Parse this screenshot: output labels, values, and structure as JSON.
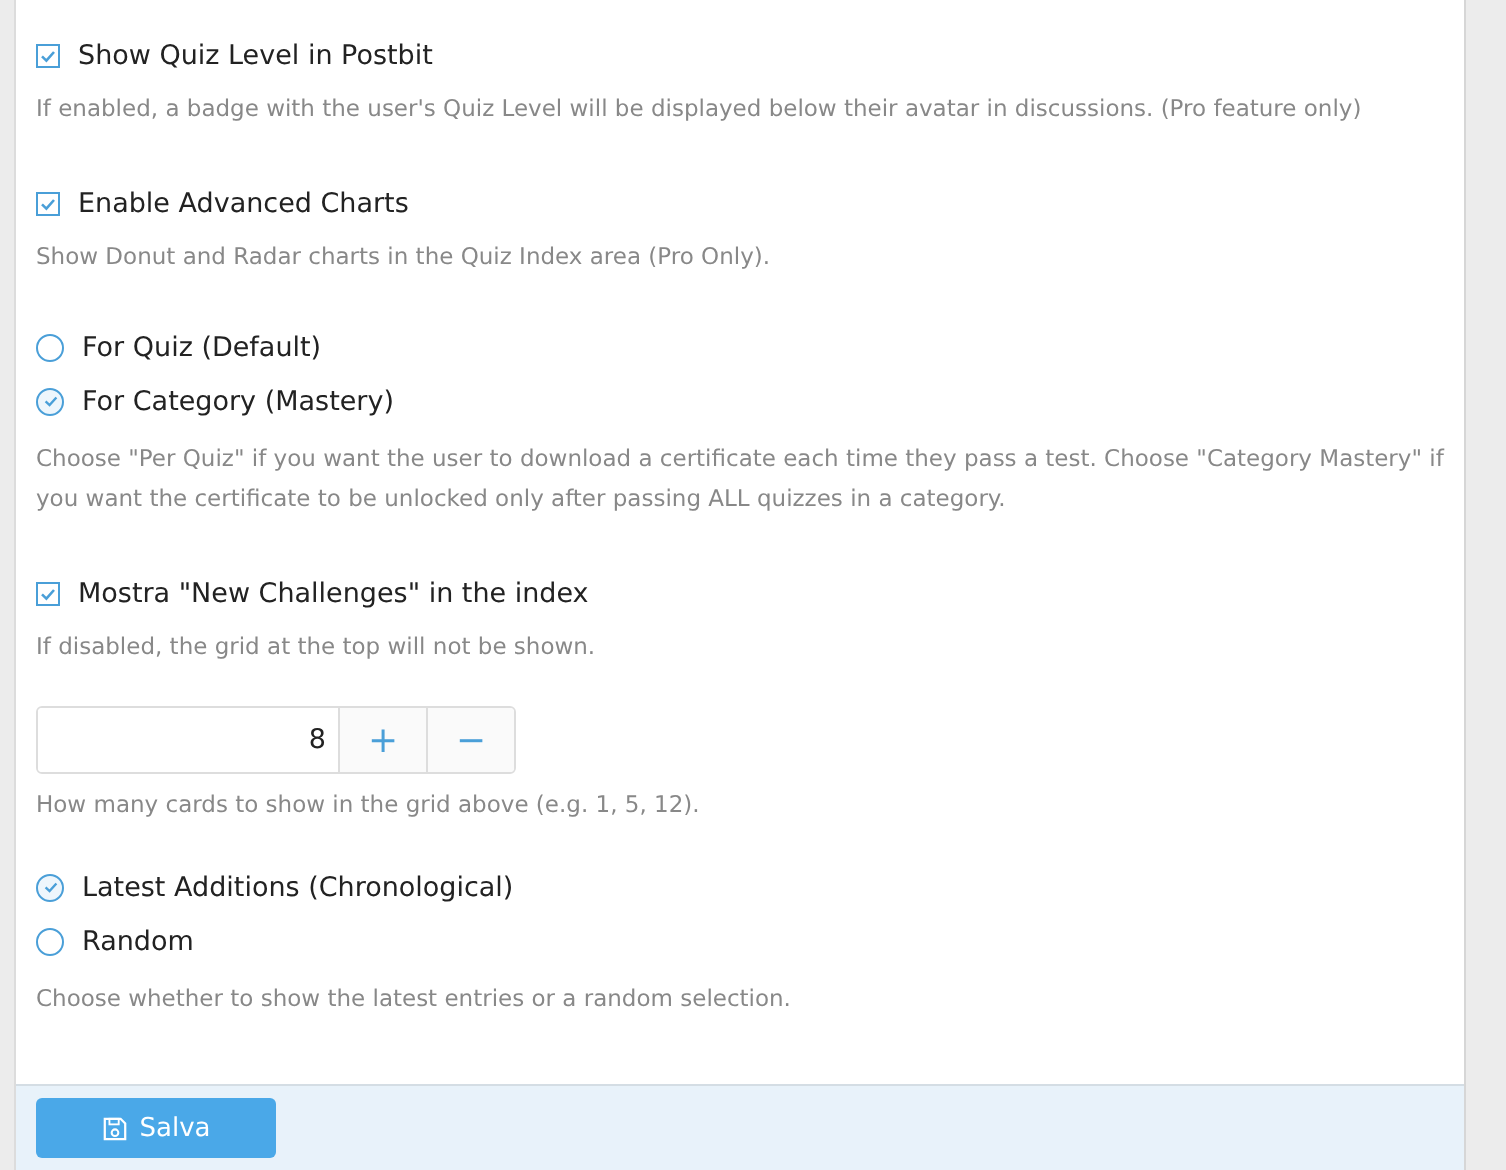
{
  "sections": [
    {
      "kind": "checkbox",
      "label": "Show Quiz Level in Postbit",
      "checked": true,
      "description": "If enabled, a badge with the user's Quiz Level will be displayed below their avatar in discussions. (Pro feature only)"
    },
    {
      "kind": "checkbox",
      "label": "Enable Advanced Charts",
      "checked": true,
      "description": "Show Donut and Radar charts in the Quiz Index area (Pro Only)."
    },
    {
      "kind": "radio",
      "options": [
        {
          "label": "For Quiz (Default)",
          "selected": false
        },
        {
          "label": "For Category (Mastery)",
          "selected": true
        }
      ],
      "description": "Choose \"Per Quiz\" if you want the user to download a certificate each time they pass a test. Choose \"Category Mastery\" if you want the certificate to be unlocked only after passing ALL quizzes in a category."
    },
    {
      "kind": "checkbox",
      "label": "Mostra \"New Challenges\" in the index",
      "checked": true,
      "description": "If disabled, the grid at the top will not be shown."
    },
    {
      "kind": "number",
      "value": "8",
      "plus": "+",
      "minus": "−",
      "description": "How many cards to show in the grid above (e.g. 1, 5, 12)."
    },
    {
      "kind": "radio",
      "options": [
        {
          "label": "Latest Additions (Chronological)",
          "selected": true
        },
        {
          "label": "Random",
          "selected": false
        }
      ],
      "description": "Choose whether to show the latest entries or a random selection."
    }
  ],
  "save_button": {
    "label": "Salva"
  }
}
